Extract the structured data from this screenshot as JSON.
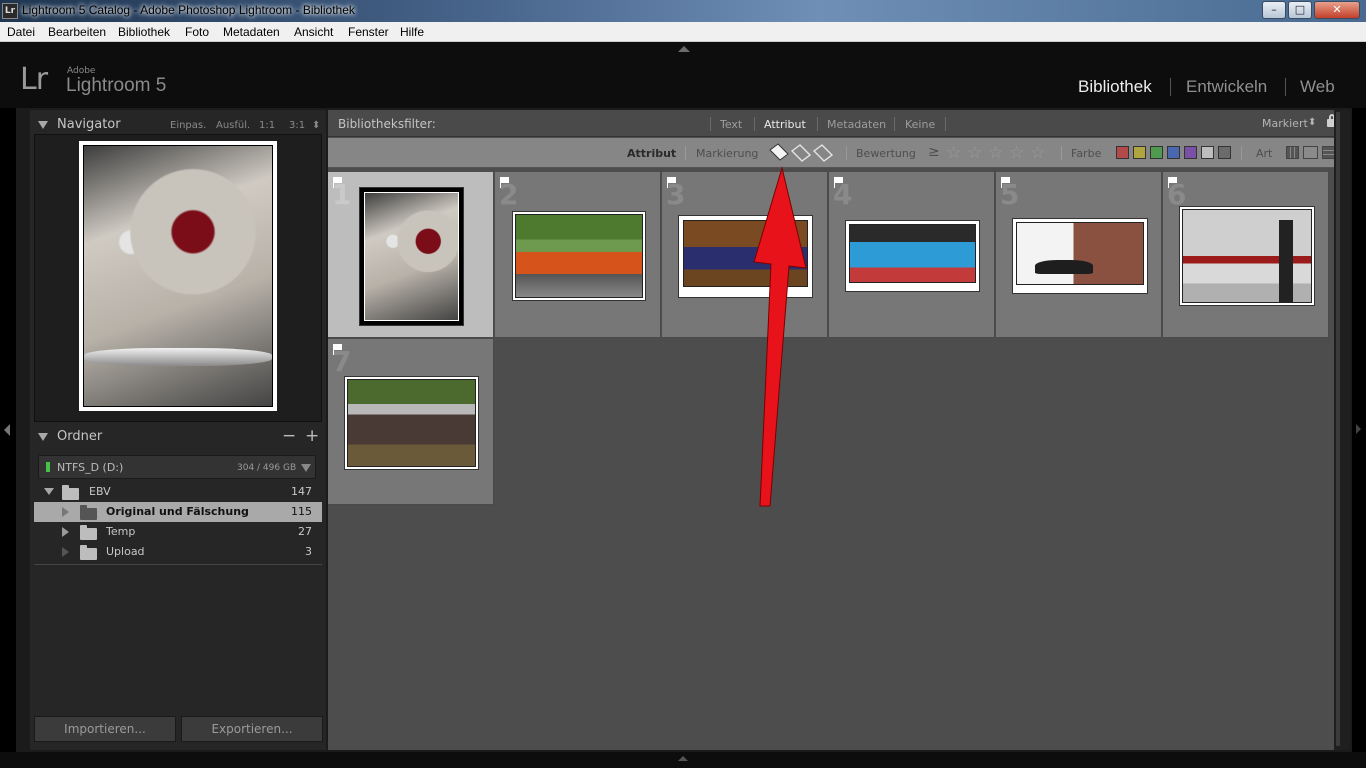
{
  "window": {
    "icon_label": "Lr",
    "title": "Lightroom 5 Catalog - Adobe Photoshop Lightroom - Bibliothek",
    "minimize_label": "–",
    "maximize_label": "□",
    "close_label": "✕"
  },
  "menu": [
    "Datei",
    "Bearbeiten",
    "Bibliothek",
    "Foto",
    "Metadaten",
    "Ansicht",
    "Fenster",
    "Hilfe"
  ],
  "header": {
    "logo_mark": "Lr",
    "logo_adobe": "Adobe",
    "logo_product": "Lightroom 5",
    "modules": [
      "Bibliothek",
      "Entwickeln",
      "Web"
    ],
    "active_module": "Bibliothek"
  },
  "navigator": {
    "title": "Navigator",
    "zoom_options": [
      "Einpas.",
      "Ausfül.",
      "1:1",
      "3:1"
    ],
    "zoom_arrows": "⬍"
  },
  "folders": {
    "title": "Ordner",
    "remove_label": "−",
    "add_label": "+",
    "volume": {
      "name": "NTFS_D (D:)",
      "usage": "304 / 496 GB"
    },
    "items": [
      {
        "name": "EBV",
        "count": "147"
      },
      {
        "name": "Original und Fälschung",
        "count": "115"
      },
      {
        "name": "Temp",
        "count": "27"
      },
      {
        "name": "Upload",
        "count": "3"
      }
    ]
  },
  "buttons": {
    "import": "Importieren...",
    "export": "Exportieren..."
  },
  "filter_bar": {
    "label": "Bibliotheksfilter:",
    "tabs": [
      "Text",
      "Attribut",
      "Metadaten",
      "Keine"
    ],
    "active_tab": "Attribut",
    "preset": "Markiert",
    "preset_arrows": "⬍"
  },
  "attribute_bar": {
    "attribute_label": "Attribut",
    "flag_label": "Markierung",
    "rating_label": "Bewertung",
    "rating_op": "≥",
    "stars": [
      "☆",
      "☆",
      "☆",
      "☆",
      "☆"
    ],
    "color_label": "Farbe",
    "type_label": "Art",
    "colors": [
      "#b34a4a",
      "#b0a640",
      "#4f9a4f",
      "#4a68b0",
      "#7a4fa6",
      "#bdbdbd",
      "#6b6b6b"
    ]
  },
  "grid": {
    "cells": [
      {
        "index": "1",
        "selected": true,
        "subject": "white vintage car tail light"
      },
      {
        "index": "2",
        "subject": "orange muscle car"
      },
      {
        "index": "3",
        "subject": "blue classic car in forest"
      },
      {
        "index": "4",
        "subject": "blue audi front"
      },
      {
        "index": "5",
        "subject": "black porsche"
      },
      {
        "index": "6",
        "subject": "white car rear detail"
      },
      {
        "index": "7",
        "subject": "rusty vintage car"
      }
    ]
  },
  "colors": {
    "panel_bg": "#262626",
    "grid_bg": "#4d4d4d",
    "cell_bg": "#777777",
    "cell_selected": "#bdbdbd",
    "arrow": "#e8121a"
  }
}
